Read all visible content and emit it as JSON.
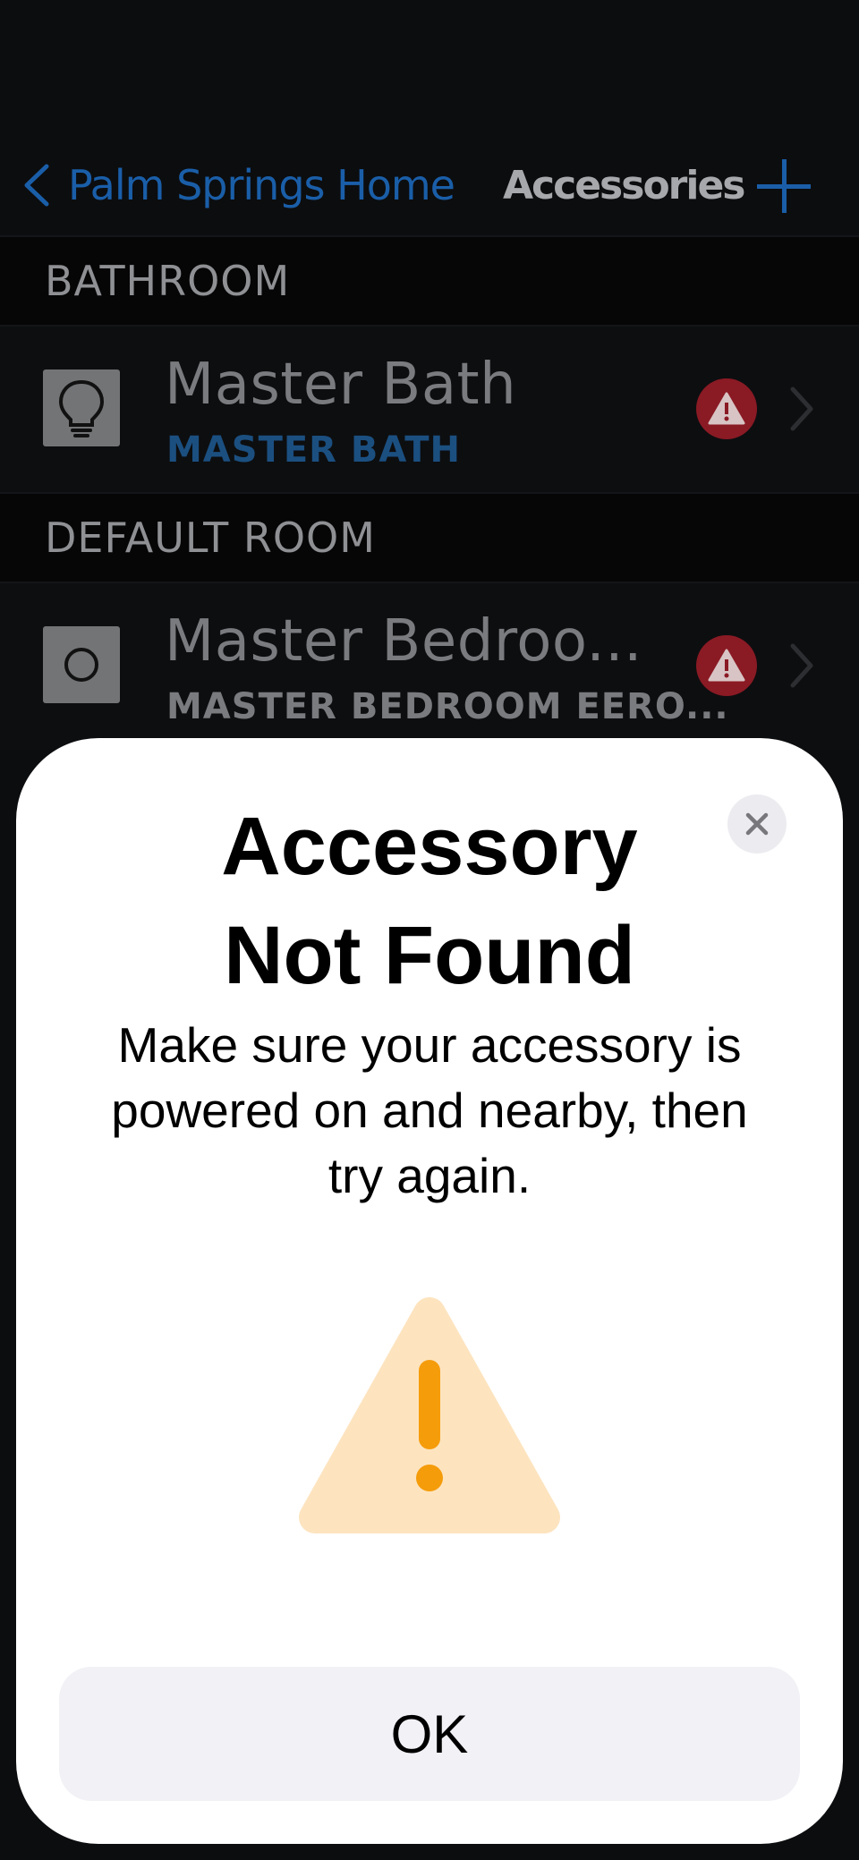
{
  "nav": {
    "back_label": "Palm Springs Home",
    "title": "Accessories",
    "add_icon": "plus-icon"
  },
  "sections": [
    {
      "header": "BATHROOM",
      "accessories": [
        {
          "name": "Master Bath",
          "subtitle": "MASTER BATH",
          "icon": "lightbulb-icon",
          "status_icon": "warning-icon"
        }
      ]
    },
    {
      "header": "DEFAULT ROOM",
      "accessories": [
        {
          "name": "Master Bedroo...",
          "subtitle": "MASTER BEDROOM EERO...",
          "icon": "circle-icon",
          "status_icon": "warning-icon"
        }
      ]
    }
  ],
  "dialog": {
    "title_line1": "Accessory",
    "title_line2": "Not Found",
    "message_line1": "Make sure your accessory is",
    "message_line2": "powered on and nearby, then",
    "message_line3": "try again.",
    "ok_label": "OK",
    "close_icon": "close-icon",
    "graphic_icon": "warning-triangle-icon"
  },
  "colors": {
    "accent_blue": "#1a5ea8",
    "alert_red": "#8a1a24",
    "warning_fill": "#fde4bf",
    "warning_mark": "#f59c0b",
    "sheet_bg": "#ffffff",
    "button_bg": "#f1f1f6"
  }
}
